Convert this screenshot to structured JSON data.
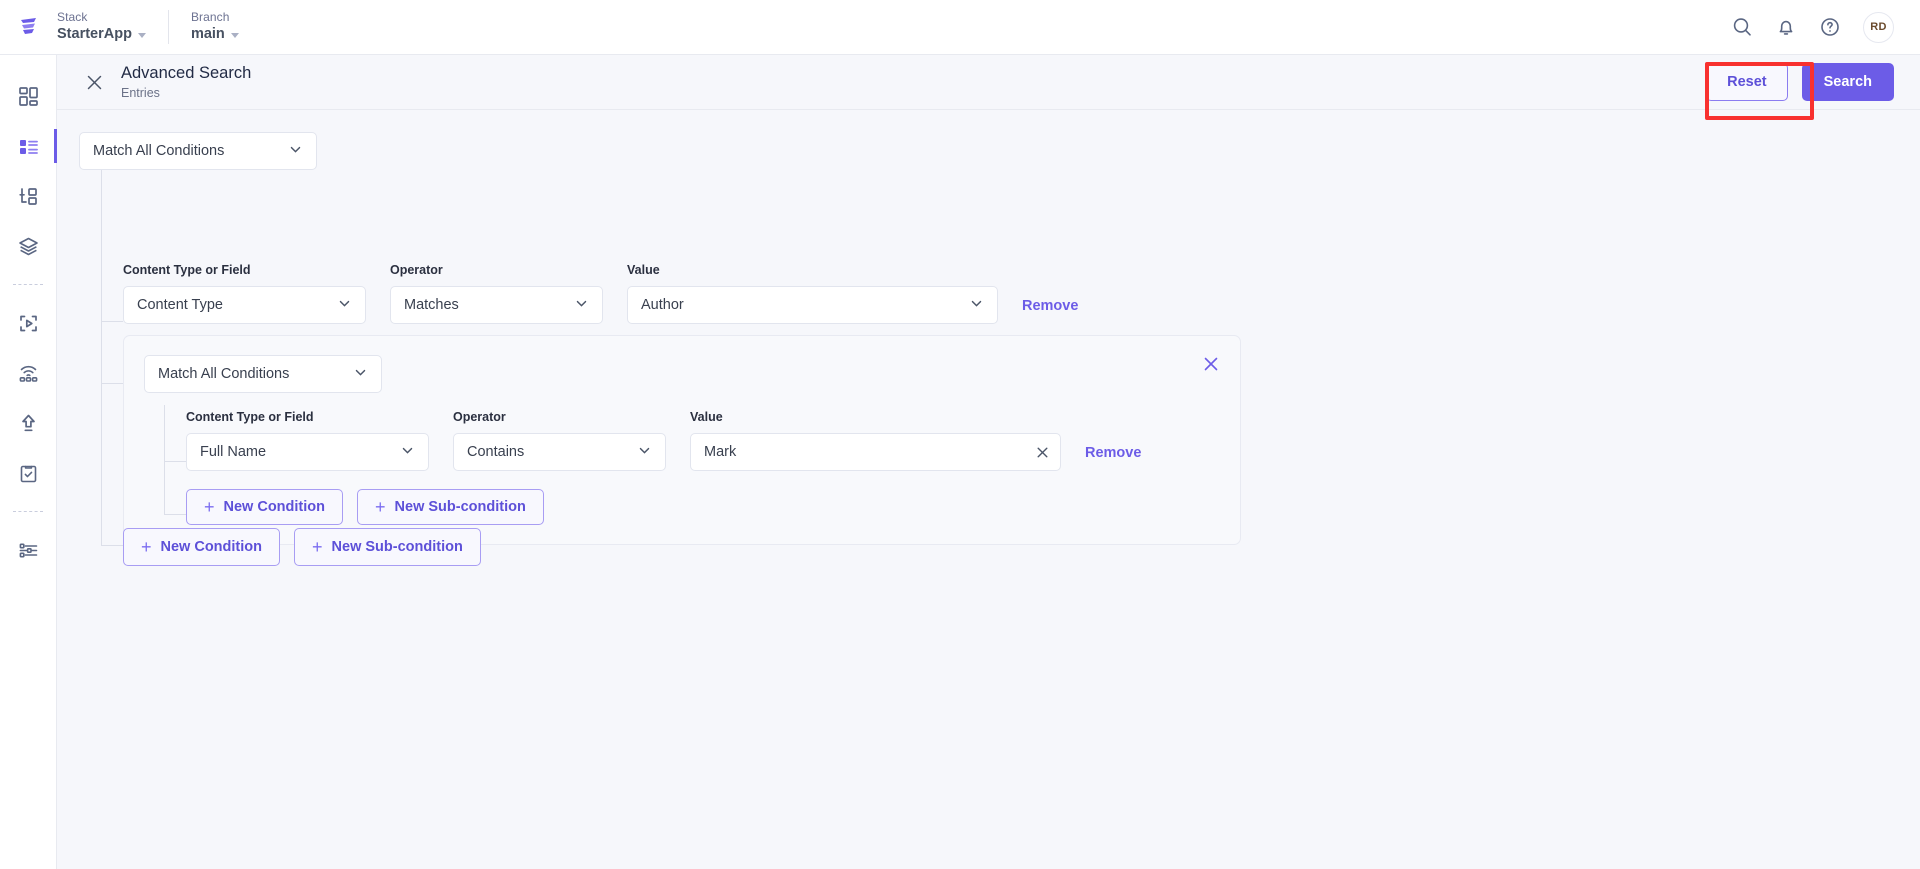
{
  "topbar": {
    "logo_icon": "contentstack-logo-icon",
    "stack": {
      "label": "Stack",
      "value": "StarterApp"
    },
    "branch": {
      "label": "Branch",
      "value": "main"
    },
    "actions": [
      {
        "name": "search-icon",
        "title": "Search"
      },
      {
        "name": "bell-icon",
        "title": "Notifications"
      },
      {
        "name": "help-icon",
        "title": "Help"
      }
    ],
    "avatar_initials": "RD"
  },
  "sidebar": {
    "items": [
      {
        "icon": "dashboard-grid-icon",
        "active": false
      },
      {
        "icon": "entries-list-icon",
        "active": true
      },
      {
        "icon": "content-types-icon",
        "active": false
      },
      {
        "icon": "assets-layers-icon",
        "active": false
      },
      {
        "divider": true
      },
      {
        "icon": "live-preview-icon",
        "active": false
      },
      {
        "icon": "releases-broadcast-icon",
        "active": false
      },
      {
        "icon": "publish-queue-icon",
        "active": false
      },
      {
        "icon": "tasks-clipboard-icon",
        "active": false
      },
      {
        "divider": true
      },
      {
        "icon": "settings-sliders-icon",
        "active": false
      }
    ]
  },
  "header": {
    "close_icon": "close-icon",
    "title": "Advanced Search",
    "subtitle": "Entries",
    "reset_label": "Reset",
    "search_label": "Search",
    "highlight_color": "#f8312f",
    "accent_color": "#6c5ce7"
  },
  "builder": {
    "root_match": "Match All Conditions",
    "labels": {
      "content_type_or_field": "Content Type or Field",
      "operator": "Operator",
      "value": "Value"
    },
    "root_condition": {
      "field": "Content Type",
      "operator": "Matches",
      "value": "Author",
      "remove_label": "Remove"
    },
    "subgroup": {
      "match": "Match All Conditions",
      "close_icon": "close-icon",
      "condition": {
        "field": "Full Name",
        "operator": "Contains",
        "value": "Mark",
        "clear_icon": "clear-icon",
        "remove_label": "Remove"
      },
      "new_condition_label": "New Condition",
      "new_subcondition_label": "New Sub-condition"
    },
    "new_condition_label": "New Condition",
    "new_subcondition_label": "New Sub-condition"
  }
}
